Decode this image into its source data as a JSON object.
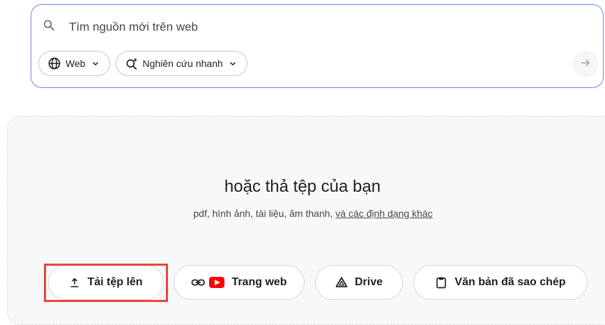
{
  "search": {
    "placeholder": "Tìm nguồn mới trên web",
    "source_chip": "Web",
    "mode_chip": "Nghiên cứu nhanh"
  },
  "drop_zone": {
    "title": "hoặc thả tệp của bạn",
    "subtitle": "pdf, hình ảnh, tài liệu, âm thanh,",
    "more_formats_link": "và các định dạng khác"
  },
  "source_buttons": {
    "upload": "Tải tệp lên",
    "website": "Trang web",
    "drive": "Drive",
    "copied_text": "Văn bản đã sao chép"
  },
  "colors": {
    "accent_border": "#6f8cf0",
    "highlight": "#e8453c",
    "youtube_red": "#ff0000"
  }
}
